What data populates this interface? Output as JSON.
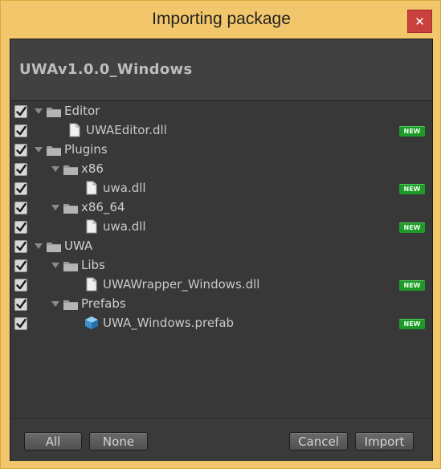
{
  "window": {
    "title": "Importing package",
    "close_glyph": "✕"
  },
  "package": {
    "name": "UWAv1.0.0_Windows"
  },
  "tree": [
    {
      "label": "Editor",
      "type": "folder",
      "checked": true,
      "expanded": true,
      "new": false
    },
    {
      "label": "UWAEditor.dll",
      "type": "file",
      "checked": true,
      "new": true
    },
    {
      "label": "Plugins",
      "type": "folder",
      "checked": true,
      "expanded": true,
      "new": false
    },
    {
      "label": "x86",
      "type": "folder",
      "checked": true,
      "expanded": true,
      "new": false
    },
    {
      "label": "uwa.dll",
      "type": "file",
      "checked": true,
      "new": true
    },
    {
      "label": "x86_64",
      "type": "folder",
      "checked": true,
      "expanded": true,
      "new": false
    },
    {
      "label": "uwa.dll",
      "type": "file",
      "checked": true,
      "new": true
    },
    {
      "label": "UWA",
      "type": "folder",
      "checked": true,
      "expanded": true,
      "new": false
    },
    {
      "label": "Libs",
      "type": "folder",
      "checked": true,
      "expanded": true,
      "new": false
    },
    {
      "label": "UWAWrapper_Windows.dll",
      "type": "file",
      "checked": true,
      "new": true
    },
    {
      "label": "Prefabs",
      "type": "folder",
      "checked": true,
      "expanded": true,
      "new": false
    },
    {
      "label": "UWA_Windows.prefab",
      "type": "prefab",
      "checked": true,
      "new": true
    }
  ],
  "badge": {
    "new_label": "NEW",
    "color": "#1e9a2a"
  },
  "buttons": {
    "all": "All",
    "none": "None",
    "cancel": "Cancel",
    "import": "Import"
  },
  "colors": {
    "title_bg": "#f2c66a",
    "panel_bg": "#383838",
    "close_bg": "#c9403c",
    "prefab_icon": "#4aa3e0"
  }
}
